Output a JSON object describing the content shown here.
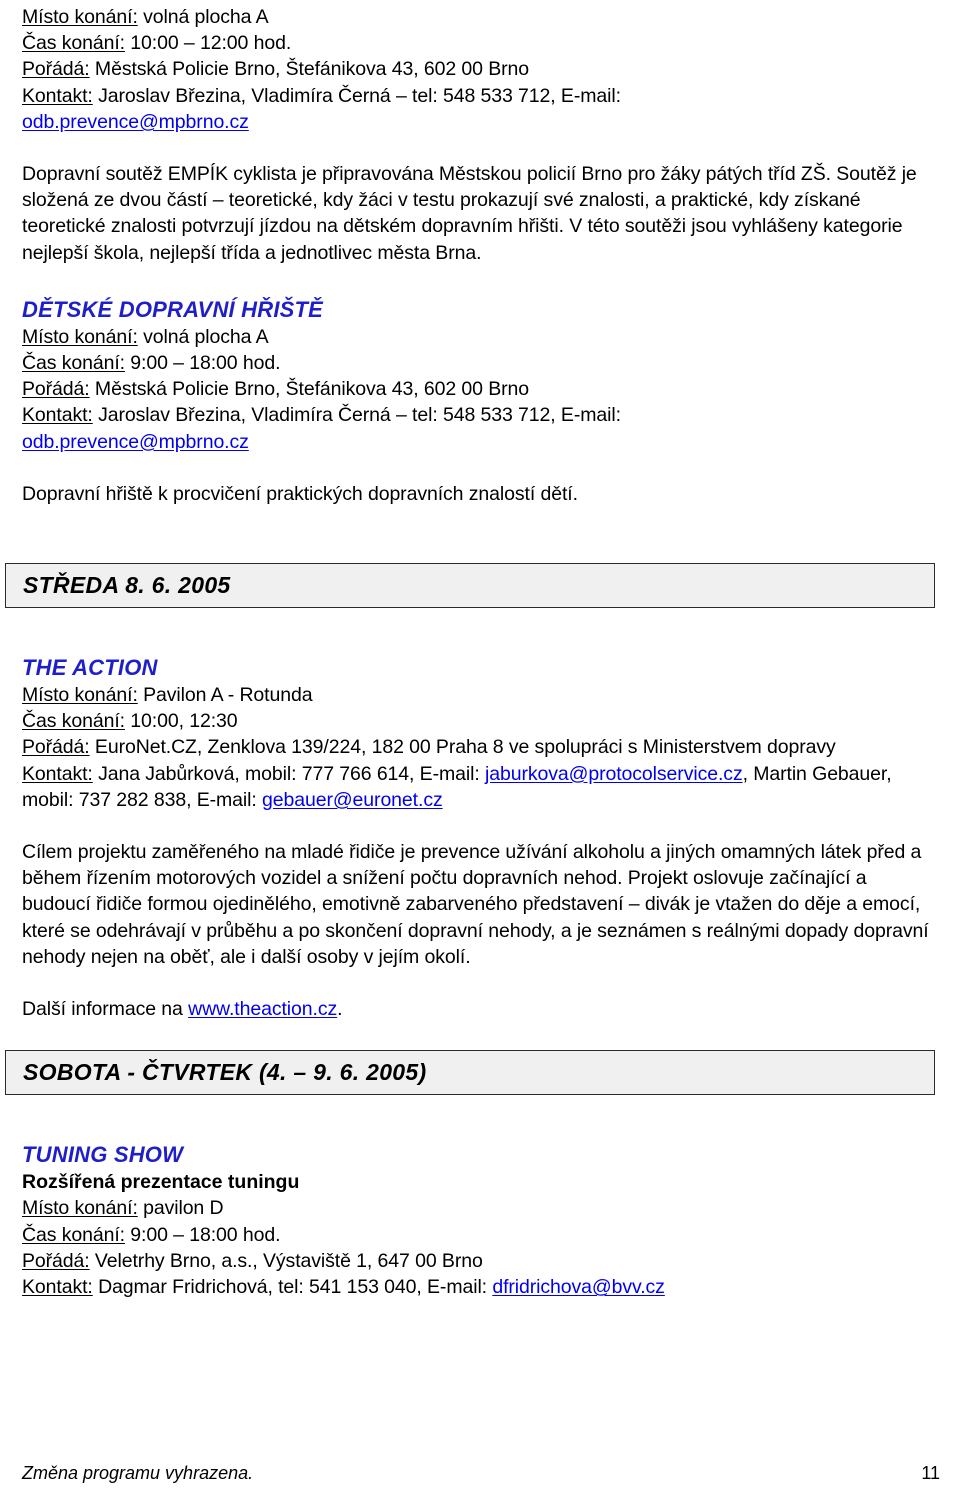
{
  "document": {
    "language": "cs",
    "accent_blue": "#1f1fc9",
    "date_bar_bg": "#f0f0f0",
    "date_bar_border": "#2b2b2b"
  },
  "sections": [
    {
      "id": "empik-cyklista-details",
      "details": [
        {
          "label": "Místo konání:",
          "value": " volná plocha A"
        },
        {
          "label": "Čas konání:",
          "value": " 10:00 – 12:00 hod."
        },
        {
          "label": "Pořádá:",
          "value": " Městská Policie Brno, Štefánikova 43, 602 00 Brno"
        },
        {
          "label": "Kontakt:",
          "value": " Jaroslav Březina, Vladimíra Černá – tel: 548 533 712, E-mail:"
        }
      ],
      "email": "odb.prevence@mpbrno.cz",
      "description": "Dopravní soutěž EMPÍK cyklista je připravována Městskou policií Brno pro žáky pátých tříd ZŠ. Soutěž je složená ze dvou částí – teoretické, kdy žáci v testu prokazují své znalosti, a praktické, kdy získané teoretické znalosti potvrzují jízdou na dětském dopravním hřišti. V této soutěži jsou vyhlášeny kategorie nejlepší škola, nejlepší třída a jednotlivec města Brna."
    },
    {
      "id": "detske-dopravni-hriste",
      "heading": "DĚTSKÉ DOPRAVNÍ HŘIŠTĚ",
      "details": [
        {
          "label": "Místo konání:",
          "value": " volná plocha A"
        },
        {
          "label": "Čas konání:",
          "value": " 9:00 – 18:00 hod."
        },
        {
          "label": "Pořádá:",
          "value": " Městská Policie Brno, Štefánikova 43, 602 00 Brno"
        },
        {
          "label": "Kontakt:",
          "value": " Jaroslav Březina, Vladimíra Černá – tel: 548 533 712, E-mail:"
        }
      ],
      "email": "odb.prevence@mpbrno.cz",
      "description": "Dopravní hřiště k procvičení praktických dopravních znalostí dětí."
    }
  ],
  "date_bar_1": "STŘEDA 8. 6. 2005",
  "the_action": {
    "heading": "THE ACTION",
    "place_label": "Místo konání:",
    "place_value": " Pavilon A - Rotunda",
    "time_label": "Čas konání:",
    "time_value": " 10:00, 12:30",
    "organizer_label": "Pořádá:",
    "organizer_value": " EuroNet.CZ, Zenklova 139/224, 182 00 Praha 8 ve spolupráci s Ministerstvem dopravy",
    "contact_label": "Kontakt:",
    "contact_part1": " Jana Jabůrková, mobil: 777 766 614, E-mail: ",
    "contact_email1": "jaburkova@protocolservice.cz",
    "contact_part2": ", Martin Gebauer, mobil: 737 282 838, E-mail: ",
    "contact_email2": "gebauer@euronet.cz",
    "description": "Cílem projektu zaměřeného na mladé řidiče je prevence užívání alkoholu a jiných omamných látek před a během řízením motorových vozidel a snížení počtu dopravních nehod. Projekt oslovuje začínající a budoucí řidiče formou ojedinělého, emotivně zabarveného představení – divák je vtažen do děje a emocí, které se odehrávají v průběhu a po skončení dopravní nehody, a je seznámen s reálnými dopady dopravní nehody nejen na oběť, ale i další osoby v jejím okolí.",
    "more_info_prefix": "Další informace na ",
    "more_info_link": "www.theaction.cz",
    "more_info_suffix": "."
  },
  "date_bar_2": "SOBOTA  - ČTVRTEK (4. – 9. 6. 2005)",
  "tuning_show": {
    "heading": "TUNING SHOW",
    "subheading": "Rozšířená prezentace tuningu",
    "place_label": "Místo konání:",
    "place_value": " pavilon D",
    "time_label": "Čas konání:",
    "time_value": " 9:00 – 18:00 hod.",
    "organizer_label": "Pořádá:",
    "organizer_value": " Veletrhy Brno, a.s., Výstaviště 1, 647 00 Brno",
    "contact_label": "Kontakt:",
    "contact_value": " Dagmar Fridrichová, tel: 541 153 040, E-mail: ",
    "contact_email": "dfridrichova@bvv.cz"
  },
  "footer": {
    "note": "Změna programu vyhrazena.",
    "page_number": "11"
  }
}
